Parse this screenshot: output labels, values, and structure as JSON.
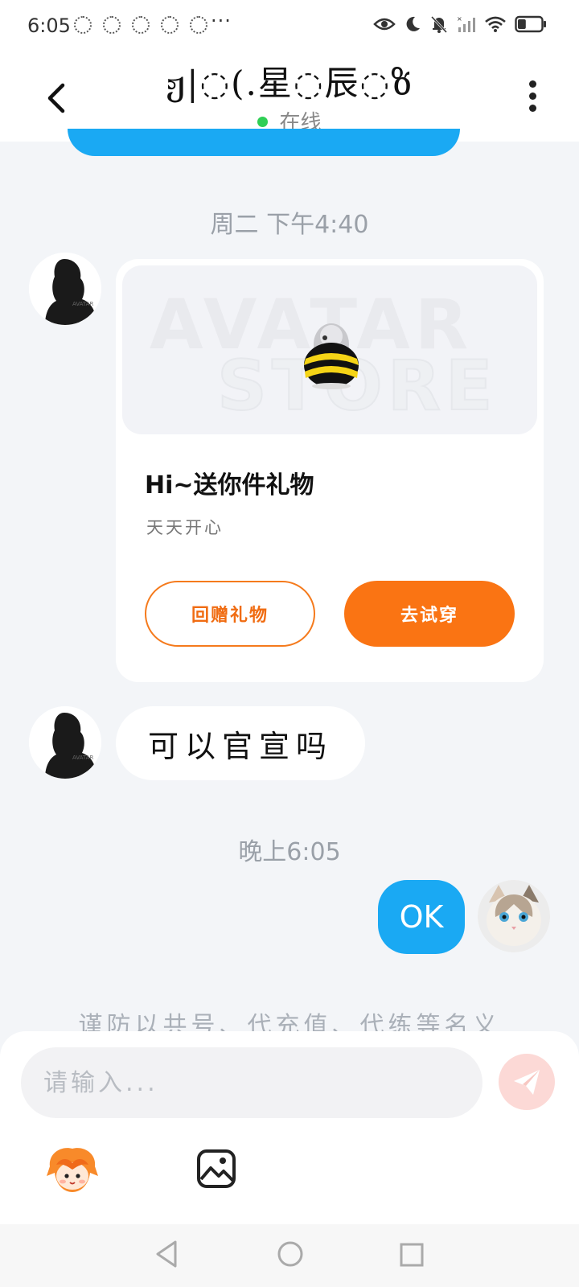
{
  "status_bar": {
    "time": "6:05",
    "more": "···",
    "battery_level": 0.35
  },
  "header": {
    "contact_name": "ჟ|◌(.星◌辰◌ზ",
    "online_status": "在线",
    "online_color": "#2fcf55"
  },
  "messages": {
    "timestamp_1": "周二 下午4:40",
    "gift_card": {
      "watermark_line1": "AVATAR",
      "watermark_line2": "STORE",
      "title": "Hi~送你件礼物",
      "subtitle": "天天开心",
      "return_gift_label": "回赠礼物",
      "try_on_label": "去试穿"
    },
    "incoming_text": "可以官宣吗",
    "timestamp_2": "晚上6:05",
    "outgoing_text": "OK",
    "warning_text": "谨防以共号、代充值、代练等名义"
  },
  "input": {
    "placeholder": "请输入..."
  },
  "colors": {
    "accent_blue": "#1aa9f3",
    "accent_orange": "#fa7413"
  },
  "icons": {
    "back": "chevron-left-icon",
    "more": "vertical-dots-icon",
    "send": "paper-plane-icon",
    "mascot": "mascot-emoji-icon",
    "image": "image-icon"
  }
}
